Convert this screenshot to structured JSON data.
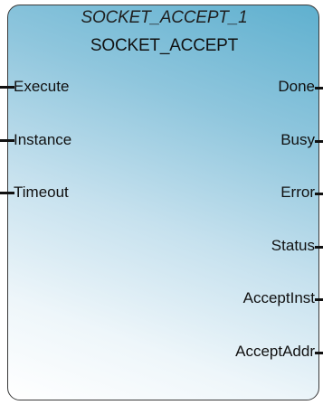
{
  "block": {
    "instance_name": "SOCKET_ACCEPT_1",
    "type_name": "SOCKET_ACCEPT",
    "inputs": [
      "Execute",
      "Instance",
      "Timeout"
    ],
    "outputs": [
      "Done",
      "Busy",
      "Error",
      "Status",
      "AcceptInst",
      "AcceptAddr"
    ]
  },
  "colors": {
    "gradient_dark": "#5fb0cf",
    "gradient_light": "#ffffff",
    "border": "#3a3a3a",
    "text": "#111111"
  }
}
